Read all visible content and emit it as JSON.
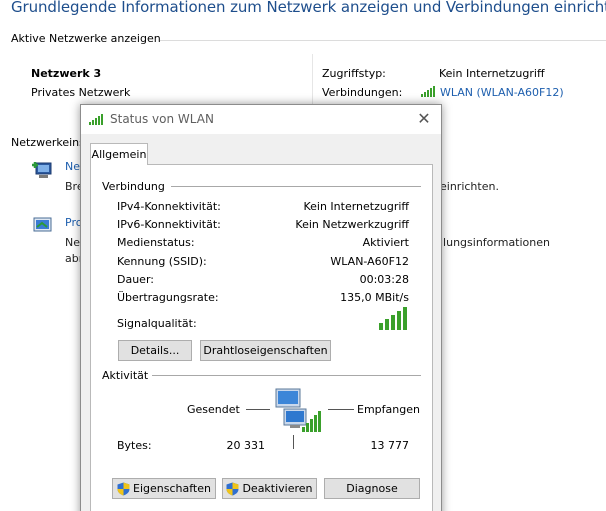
{
  "page": {
    "heading": "Grundlegende Informationen zum Netzwerk anzeigen und Verbindungen einrichten",
    "active_networks_label": "Aktive Netzwerke anzeigen",
    "network_name": "Netzwerk 3",
    "network_type": "Privates Netzwerk",
    "access_type_label": "Zugriffstyp:",
    "access_type_value": "Kein Internetzugriff",
    "connections_label": "Verbindungen:",
    "connections_value": "WLAN (WLAN-A60F12)",
    "change_settings_label_partial": "Netzwerkeins",
    "item1_title_partial": "Ne",
    "item1_desc_partial": "Bre",
    "item1_desc_right": "einrichten.",
    "item2_title_partial": "Pro",
    "item2_desc_partial1": "Ne",
    "item2_desc_partial2": "abr",
    "item2_desc_right": "ilungsinformationen"
  },
  "dialog": {
    "title": "Status von WLAN",
    "close_symbol": "✕",
    "tab_label": "Allgemein",
    "connection_group": "Verbindung",
    "rows": [
      {
        "label": "IPv4-Konnektivität:",
        "value": "Kein Internetzugriff"
      },
      {
        "label": "IPv6-Konnektivität:",
        "value": "Kein Netzwerkzugriff"
      },
      {
        "label": "Medienstatus:",
        "value": "Aktiviert"
      },
      {
        "label": "Kennung (SSID):",
        "value": "WLAN-A60F12"
      },
      {
        "label": "Dauer:",
        "value": "00:03:28"
      },
      {
        "label": "Übertragungsrate:",
        "value": "135,0 MBit/s"
      }
    ],
    "signal_label": "Signalqualität:",
    "signal_bars": 5,
    "details_button": "Details...",
    "wireless_props_button": "Drahtloseigenschaften",
    "activity_group": "Aktivität",
    "sent_label": "Gesendet",
    "received_label": "Empfangen",
    "bytes_label": "Bytes:",
    "bytes_sent": "20 331",
    "bytes_received": "13 777",
    "properties_button": "Eigenschaften",
    "deactivate_button": "Deaktivieren",
    "diagnose_button": "Diagnose"
  },
  "colors": {
    "heading": "#1e4e8c",
    "link": "#1e5fae",
    "signal": "#3aa02b",
    "shield_blue": "#2f6fd0",
    "shield_yellow": "#f0c419"
  }
}
